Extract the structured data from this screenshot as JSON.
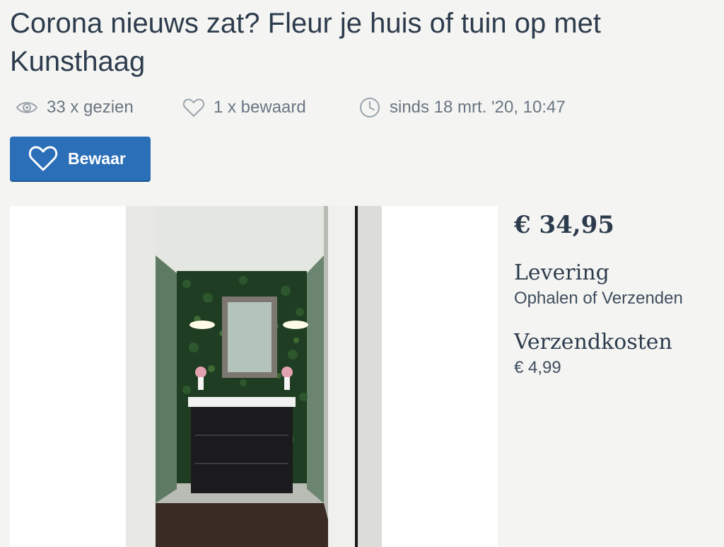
{
  "listing": {
    "title": "Corona nieuws zat? Fleur je huis of tuin op met Kunsthaag",
    "views": "33 x gezien",
    "saved": "1 x bewaard",
    "since": "sinds 18 mrt. '20, 10:47",
    "save_button": "Bewaar"
  },
  "details": {
    "price": "€ 34,95",
    "delivery_label": "Levering",
    "delivery_value": "Ophalen of Verzenden",
    "shipping_label": "Verzendkosten",
    "shipping_value": "€ 4,99"
  },
  "icons": [
    "eye-icon",
    "heart-outline-icon",
    "clock-icon",
    "heart-icon"
  ],
  "colors": {
    "accent": "#2b6fb8",
    "text": "#2d3c4d",
    "muted": "#6a7683",
    "background": "#f4f4f2"
  }
}
